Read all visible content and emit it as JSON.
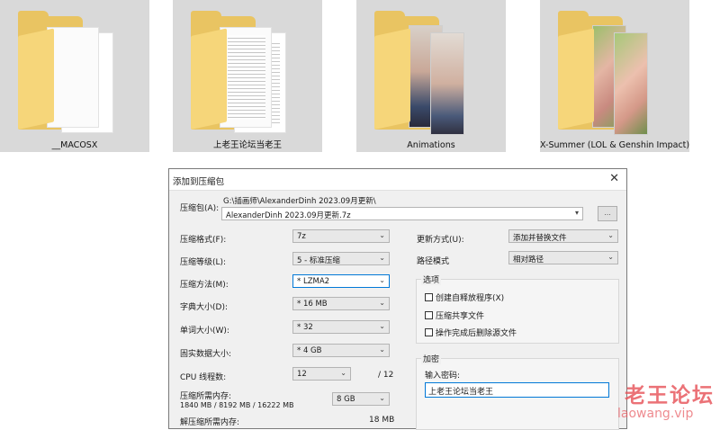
{
  "folders": [
    {
      "name": "__MACOSX"
    },
    {
      "name": "上老王论坛当老王"
    },
    {
      "name": "Animations"
    },
    {
      "name": "X-Summer (LOL & Genshin Impact)"
    }
  ],
  "dialog": {
    "title": "添加到压缩包",
    "close_glyph": "✕",
    "archive_label": "压缩包(A):",
    "archive_path": "G:\\插画师\\AlexanderDinh 2023.09月更新\\",
    "archive_name": "AlexanderDinh 2023.09月更新.7z",
    "browse_label": "...",
    "left": [
      {
        "label": "压缩格式(F):",
        "value": "7z"
      },
      {
        "label": "压缩等级(L):",
        "value": "5 - 标准压缩"
      },
      {
        "label": "压缩方法(M):",
        "value": "* LZMA2"
      },
      {
        "label": "字典大小(D):",
        "value": "* 16 MB"
      },
      {
        "label": "单词大小(W):",
        "value": "* 32"
      },
      {
        "label": "固实数据大小:",
        "value": "* 4 GB"
      }
    ],
    "cpu_label": "CPU 线程数:",
    "cpu_value": "12",
    "cpu_total": "/ 12",
    "mem_label": "压缩所需内存:",
    "mem_detail": "1840 MB / 8192 MB / 16222 MB",
    "mem_value": "8 GB",
    "decomp_label": "解压缩所需内存:",
    "decomp_value": "18 MB",
    "update_label": "更新方式(U):",
    "update_value": "添加并替换文件",
    "path_label": "路径模式",
    "path_value": "相对路径",
    "options_title": "选项",
    "options": [
      "创建自释放程序(X)",
      "压缩共享文件",
      "操作完成后删除源文件"
    ],
    "encrypt_title": "加密",
    "password_label": "输入密码:",
    "password_value": "上老王论坛当老王"
  },
  "watermark": {
    "cn": "老王论坛",
    "url": "laowang.vip"
  },
  "colors": {
    "folder": "#e9c462",
    "accent": "#0078d7",
    "watermark": "#e85a60"
  }
}
